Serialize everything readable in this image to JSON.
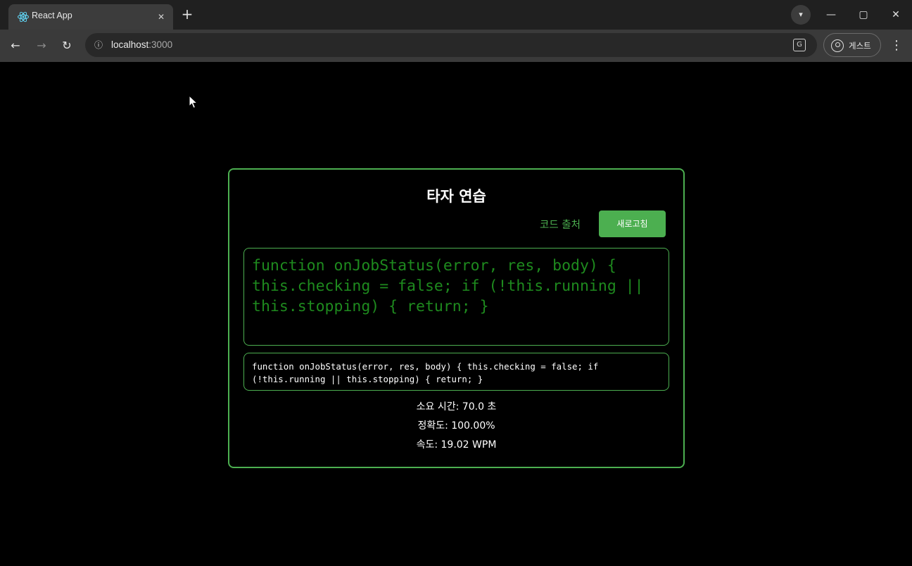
{
  "browser": {
    "tab_title": "React App",
    "tab_close": "✕",
    "new_tab": "+",
    "url_host": "localhost",
    "url_port": ":3000",
    "profile_label": "게스트",
    "menu": "⋮",
    "win_minimize": "—",
    "win_maximize": "▢",
    "win_close": "✕"
  },
  "page": {
    "title": "타자 연습",
    "source_link": "코드 출처",
    "refresh_button": "새로고침",
    "code_text": "function onJobStatus(error, res, body) { this.checking = false; if (!this.running || this.stopping) { return; }",
    "input_value": "function onJobStatus(error, res, body) { this.checking = false; if (!this.running || this.stopping) { return; }",
    "stats": {
      "time": "소요 시간: 70.0 초",
      "accuracy": "정확도: 100.00%",
      "speed": "속도: 19.02 WPM"
    }
  },
  "colors": {
    "accent": "#4caf50",
    "code_text": "#1e8a1e",
    "background": "#000000"
  }
}
